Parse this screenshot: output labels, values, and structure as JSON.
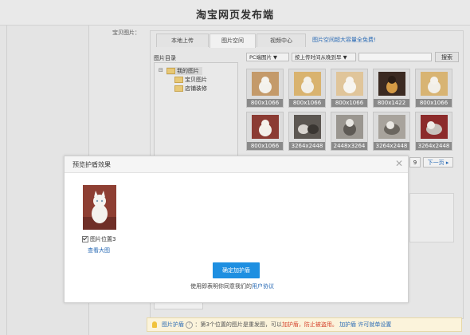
{
  "app": {
    "title": "淘宝网页发布端"
  },
  "field": {
    "label": "宝贝图片："
  },
  "tabs": [
    {
      "label": "本地上传"
    },
    {
      "label": "图片空间"
    },
    {
      "label": "视频中心"
    }
  ],
  "tab_link": "图片空间超大容量全免费!",
  "directory": {
    "title": "图片目录",
    "expander": "⊟",
    "items": [
      {
        "label": "我的图片"
      },
      {
        "label": "宝贝图片"
      },
      {
        "label": "店铺装修"
      }
    ]
  },
  "filters": {
    "source": "PC端图片 ▼",
    "sort": "按上传时间从晚到早 ▼",
    "search_button": "搜索"
  },
  "thumbnails": [
    {
      "size": "800x1066"
    },
    {
      "size": "800x1066"
    },
    {
      "size": "800x1066"
    },
    {
      "size": "800x1422"
    },
    {
      "size": "800x1066"
    },
    {
      "size": "800x1066"
    },
    {
      "size": "3264x2448"
    },
    {
      "size": "2448x3264"
    },
    {
      "size": "3264x2448"
    },
    {
      "size": "3264x2448"
    }
  ],
  "pager": {
    "page": "9",
    "next": "下一页 ▸"
  },
  "modal": {
    "title": "预览护盾效果",
    "close": "✕",
    "checkbox_label": "图片位置3",
    "view_large": "查看大图",
    "confirm_button": "确定加护盾",
    "agree_prefix": "使用即表明你同意我们的",
    "agree_link": "用户协议"
  },
  "tip": {
    "label": "图片护盾",
    "q": "?",
    "text_1": "：第3个位置的图片是重发图，可以",
    "red": "加护盾，防止被盗用。",
    "link": "加护盾 许可就单设置"
  },
  "colors": {
    "accent_blue": "#1e8fe1",
    "link_blue": "#2a6bb5",
    "tip_bg": "#fbf3db"
  }
}
